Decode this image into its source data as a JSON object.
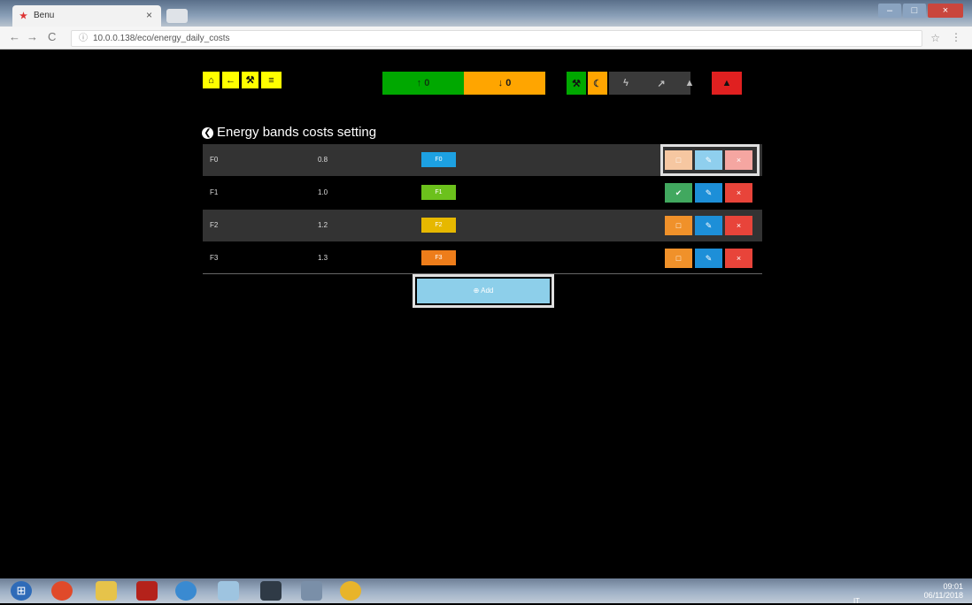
{
  "browser": {
    "tab_title": "Benu",
    "tab_favicon": "★",
    "tab_close": "×",
    "url": "10.0.0.138/eco/energy_daily_costs",
    "back": "←",
    "forward": "→",
    "reload": "C",
    "info_icon": "ⓘ",
    "bookmark_star": "☆",
    "menu": "⋮",
    "win_minimize": "–",
    "win_maximize": "□",
    "win_close": "×"
  },
  "header": {
    "home_icon": "⌂",
    "back_icon": "←",
    "tools_icon": "⚒",
    "menu_icon": "≡",
    "upload_button": "↑ 0",
    "download_button": "↓ 0",
    "status_icons": [
      "⚒",
      "☾",
      "ϟ",
      "↗",
      "▲",
      "▲"
    ]
  },
  "page": {
    "title": "Energy bands costs setting",
    "title_icon": "❮"
  },
  "bands": [
    {
      "name": "F0",
      "value": "0.8",
      "badge": "F0",
      "color": "#1da1e2",
      "first_action": "□"
    },
    {
      "name": "F1",
      "value": "1.0",
      "badge": "F1",
      "color": "#6cc11c",
      "first_action": "✔"
    },
    {
      "name": "F2",
      "value": "1.2",
      "badge": "F2",
      "color": "#e6b800",
      "first_action": "□"
    },
    {
      "name": "F3",
      "value": "1.3",
      "badge": "F3",
      "color": "#ee7d1a",
      "first_action": "□"
    }
  ],
  "actions": {
    "edit_icon": "✎",
    "delete_icon": "×"
  },
  "add_button": "⊕ Add",
  "taskbar": {
    "start": "⊞",
    "lang": "IT",
    "time": "09:01",
    "date": "06/11/2018"
  },
  "colors": {
    "yellow": "#ffff00",
    "green": "#00a800",
    "orange": "#ffa500",
    "red": "#e02020",
    "blue": "#1d8fd8"
  }
}
